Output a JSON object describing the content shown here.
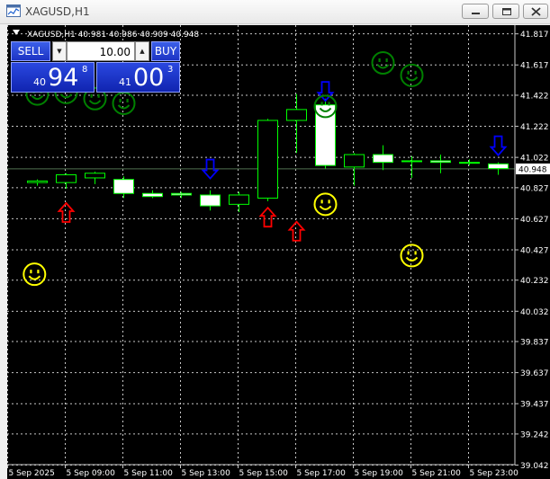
{
  "window": {
    "title": "XAGUSD,H1",
    "icon": "chart-window-icon",
    "buttons": [
      "minimize-icon",
      "restore-icon",
      "close-icon"
    ]
  },
  "chart_info": {
    "header": "XAGUSD,H1  40.981 40.986 40.909 40.948"
  },
  "trade_panel": {
    "sell_label": "SELL",
    "buy_label": "BUY",
    "lot_value": "10.00",
    "bid": {
      "prefix": "40",
      "big": "94",
      "sup": "8"
    },
    "ask": {
      "prefix": "41",
      "big": "00",
      "sup": "3"
    }
  },
  "colors": {
    "background": "#000000",
    "grid": "#c8c8c8",
    "candle": "#00ff00",
    "bull_body": "#000000",
    "bear_body": "#ffffff",
    "arrow_up": "#ff0000",
    "arrow_down": "#0000ff",
    "smiley_green": "#008000",
    "smiley_yellow": "#ffff00",
    "axis_text": "#ffffff",
    "price_label_bg": "#ffffff"
  },
  "chart_data": {
    "type": "candlestick",
    "symbol": "XAGUSD",
    "timeframe": "H1",
    "current_price": 40.948,
    "current_price_label": "40.948",
    "ylim": [
      39.042,
      41.87
    ],
    "y_ticks": [
      "41.817",
      "41.617",
      "41.422",
      "41.222",
      "41.022",
      "40.827",
      "40.627",
      "40.427",
      "40.232",
      "40.032",
      "39.837",
      "39.637",
      "39.437",
      "39.242",
      "39.042"
    ],
    "x_ticks": [
      "5 Sep 2025",
      "5 Sep 09:00",
      "5 Sep 11:00",
      "5 Sep 13:00",
      "5 Sep 15:00",
      "5 Sep 17:00",
      "5 Sep 19:00",
      "5 Sep 21:00",
      "5 Sep 23:00"
    ],
    "grid": true,
    "candles": [
      {
        "o": 40.86,
        "h": 40.88,
        "l": 40.84,
        "c": 40.87
      },
      {
        "o": 40.86,
        "h": 40.92,
        "l": 40.82,
        "c": 40.91
      },
      {
        "o": 40.89,
        "h": 40.93,
        "l": 40.85,
        "c": 40.92
      },
      {
        "o": 40.88,
        "h": 40.9,
        "l": 40.76,
        "c": 40.79
      },
      {
        "o": 40.79,
        "h": 40.81,
        "l": 40.76,
        "c": 40.77
      },
      {
        "o": 40.79,
        "h": 40.8,
        "l": 40.76,
        "c": 40.78
      },
      {
        "o": 40.78,
        "h": 40.81,
        "l": 40.68,
        "c": 40.71
      },
      {
        "o": 40.72,
        "h": 40.8,
        "l": 40.67,
        "c": 40.78
      },
      {
        "o": 40.76,
        "h": 41.27,
        "l": 40.74,
        "c": 41.26
      },
      {
        "o": 41.26,
        "h": 41.43,
        "l": 41.05,
        "c": 41.33
      },
      {
        "o": 41.36,
        "h": 41.4,
        "l": 40.95,
        "c": 40.97
      },
      {
        "o": 40.96,
        "h": 41.05,
        "l": 40.84,
        "c": 41.04
      },
      {
        "o": 41.04,
        "h": 41.1,
        "l": 40.94,
        "c": 40.99
      },
      {
        "o": 41.0,
        "h": 41.03,
        "l": 40.89,
        "c": 41.0
      },
      {
        "o": 41.0,
        "h": 41.04,
        "l": 40.92,
        "c": 40.99
      },
      {
        "o": 40.99,
        "h": 41.01,
        "l": 40.97,
        "c": 40.99
      },
      {
        "o": 40.98,
        "h": 40.99,
        "l": 40.91,
        "c": 40.95
      }
    ],
    "arrows_up": [
      {
        "bar": 1,
        "price": 40.67
      },
      {
        "bar": 8,
        "price": 40.64
      },
      {
        "bar": 9,
        "price": 40.55
      }
    ],
    "arrows_down": [
      {
        "bar": 6,
        "price": 40.95
      },
      {
        "bar": 10,
        "price": 41.45
      },
      {
        "bar": 16,
        "price": 41.1
      }
    ],
    "smileys_green": [
      {
        "x": 0.0,
        "price": 41.43
      },
      {
        "x": 1.0,
        "price": 41.44
      },
      {
        "x": 2.0,
        "price": 41.4
      },
      {
        "x": 3.0,
        "price": 41.37
      },
      {
        "x": 10.0,
        "price": 41.35
      },
      {
        "x": 12.0,
        "price": 41.63
      },
      {
        "x": 13.0,
        "price": 41.55
      }
    ],
    "smileys_yellow": [
      {
        "x": -0.1,
        "price": 40.27
      },
      {
        "x": 10.0,
        "price": 40.72
      },
      {
        "x": 13.0,
        "price": 40.39
      }
    ]
  }
}
